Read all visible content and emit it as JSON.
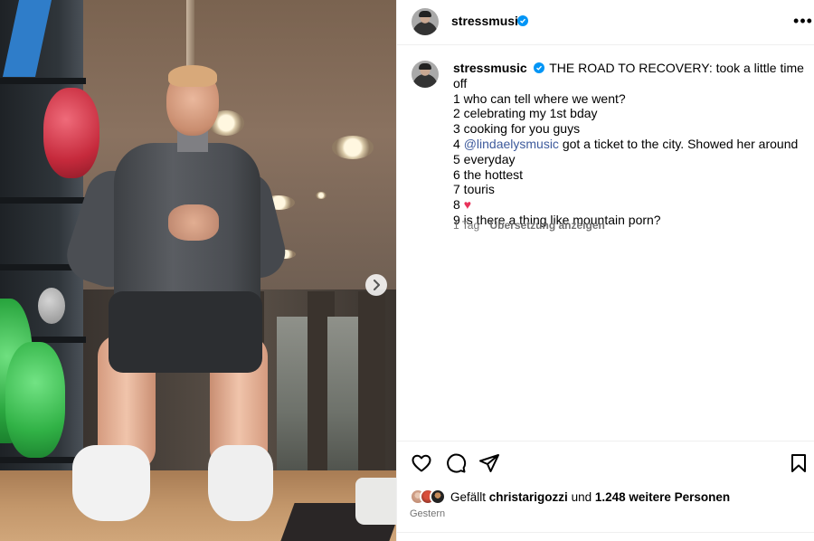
{
  "post": {
    "author": {
      "username": "stressmusic",
      "verified": true
    },
    "caption": {
      "username": "stressmusic",
      "first_line": "THE ROAD TO RECOVERY: took a little time off",
      "items": [
        "1 who can tell where we went?",
        "2 celebrating my 1st bday",
        "3 cooking for you guys"
      ],
      "item4_prefix": "4 ",
      "item4_mention": "@lindaelysmusic",
      "item4_suffix": " got a ticket to the city. Showed her around",
      "items_after": [
        "5 everyday",
        "6 the hottest",
        "7 touris"
      ],
      "item8_prefix": "8 ",
      "item8_emoji": "♥",
      "item9": "9 is there a thing like mountain porn?"
    },
    "meta": {
      "age": "1 Tag",
      "translate_label": "Übersetzung anzeigen"
    },
    "likes": {
      "prefix": "Gefällt ",
      "user": "christarigozzi",
      "middle": " und ",
      "count_text": "1.248 weitere Personen"
    },
    "posted": "Gestern"
  },
  "icons": {
    "more": "more-options-icon",
    "like": "heart-icon",
    "comment": "comment-icon",
    "share": "share-icon",
    "save": "bookmark-icon",
    "next": "chevron-right-icon",
    "verified": "verified-badge-icon"
  },
  "colors": {
    "verified": "#0095f6",
    "mention": "#3d5a9c",
    "muted": "#737373",
    "divider": "#efefef",
    "heart_emoji": "#e8325a"
  }
}
